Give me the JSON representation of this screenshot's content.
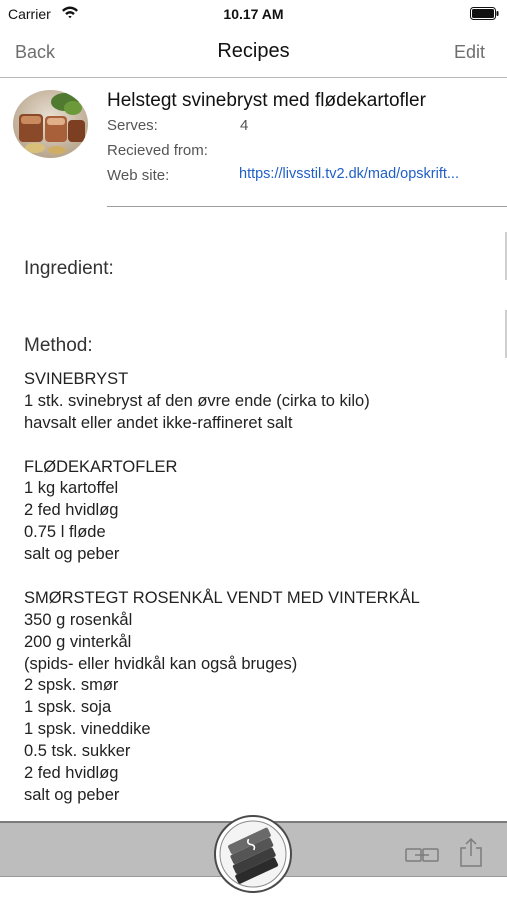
{
  "status_bar": {
    "carrier": "Carrier",
    "time": "10.17 AM"
  },
  "nav": {
    "back_label": "Back",
    "title": "Recipes",
    "edit_label": "Edit"
  },
  "recipe": {
    "title": "Helstegt svinebryst med flødekartofler",
    "serves_label": "Serves:",
    "serves_value": "4",
    "received_from_label": "Recieved from:",
    "received_from_value": "",
    "website_label": "Web site:",
    "website_value": "https://livsstil.tv2.dk/mad/opskrift..."
  },
  "sections": {
    "ingredient_header": "Ingredient:",
    "method_header": "Method:"
  },
  "method_lines": [
    "SVINEBRYST",
    "1 stk. svinebryst af den øvre ende (cirka to kilo)",
    "havsalt eller andet ikke-raffineret salt",
    "",
    "FLØDEKARTOFLER",
    "1 kg kartoffel",
    "2 fed hvidløg",
    "0.75 l fløde",
    "salt og peber",
    "",
    "SMØRSTEGT ROSENKÅL VENDT MED VINTERKÅL",
    "350 g rosenkål",
    "200 g vinterkål",
    "(spids- eller hvidkål kan også bruges)",
    "2 spsk. smør",
    "1 spsk. soja",
    "1 spsk. vineddike",
    "0.5 tsk. sukker",
    "2 fed hvidløg",
    "salt og peber"
  ],
  "colors": {
    "link": "#1f5fc8",
    "toolbar": "#bdbdbd",
    "nav_button": "#6e6e6e"
  },
  "icons": {
    "wifi": "wifi-icon",
    "battery": "battery-icon",
    "books": "recipe-books-icon",
    "link": "link-icon",
    "share": "share-icon"
  }
}
